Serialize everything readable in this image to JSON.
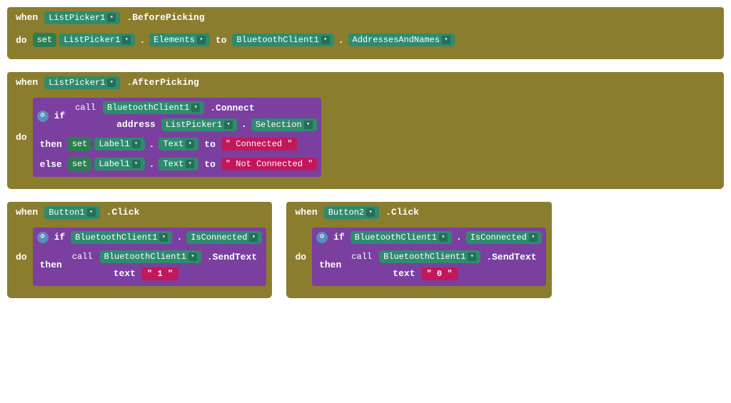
{
  "block1": {
    "when_label": "when",
    "component1": "ListPicker1",
    "event1": ".BeforePicking",
    "do_label": "do",
    "set_label": "set",
    "component2": "ListPicker1",
    "dot1": ".",
    "prop1": "Elements",
    "to_label": "to",
    "component3": "BluetoothClient1",
    "dot2": ".",
    "prop2": "AddressesAndNames"
  },
  "block2": {
    "when_label": "when",
    "component": "ListPicker1",
    "event": ".AfterPicking",
    "do_label": "do",
    "if_label": "if",
    "call_label": "call",
    "bt_component": "BluetoothClient1",
    "dot": ".",
    "method": ".Connect",
    "address_label": "address",
    "lp_component": "ListPicker1",
    "selection": "Selection",
    "then_label": "then",
    "set_label": "set",
    "label_comp": "Label1",
    "text_prop": "Text",
    "to_label": "to",
    "connected_val": "\" Connected \"",
    "else_label": "else",
    "set_label2": "set",
    "label_comp2": "Label1",
    "text_prop2": "Text",
    "to_label2": "to",
    "not_connected_val": "\" Not Connected \""
  },
  "block3": {
    "when_label": "when",
    "component": "Button1",
    "event": ".Click",
    "do_label": "do",
    "if_label": "if",
    "bt_component": "BluetoothClient1",
    "dot": ".",
    "is_connected": "IsConnected",
    "then_label": "then",
    "call_label": "call",
    "bt_comp2": "BluetoothClient1",
    "send_text": ".SendText",
    "text_label": "text",
    "text_val": "\" 1 \""
  },
  "block4": {
    "when_label": "when",
    "component": "Button2",
    "event": ".Click",
    "do_label": "do",
    "if_label": "if",
    "bt_component": "BluetoothClient1",
    "dot": ".",
    "is_connected": "IsConnected",
    "then_label": "then",
    "call_label": "call",
    "bt_comp2": "BluetoothClient1",
    "send_text": ".SendText",
    "text_label": "text",
    "text_val": "\" 0 \""
  }
}
